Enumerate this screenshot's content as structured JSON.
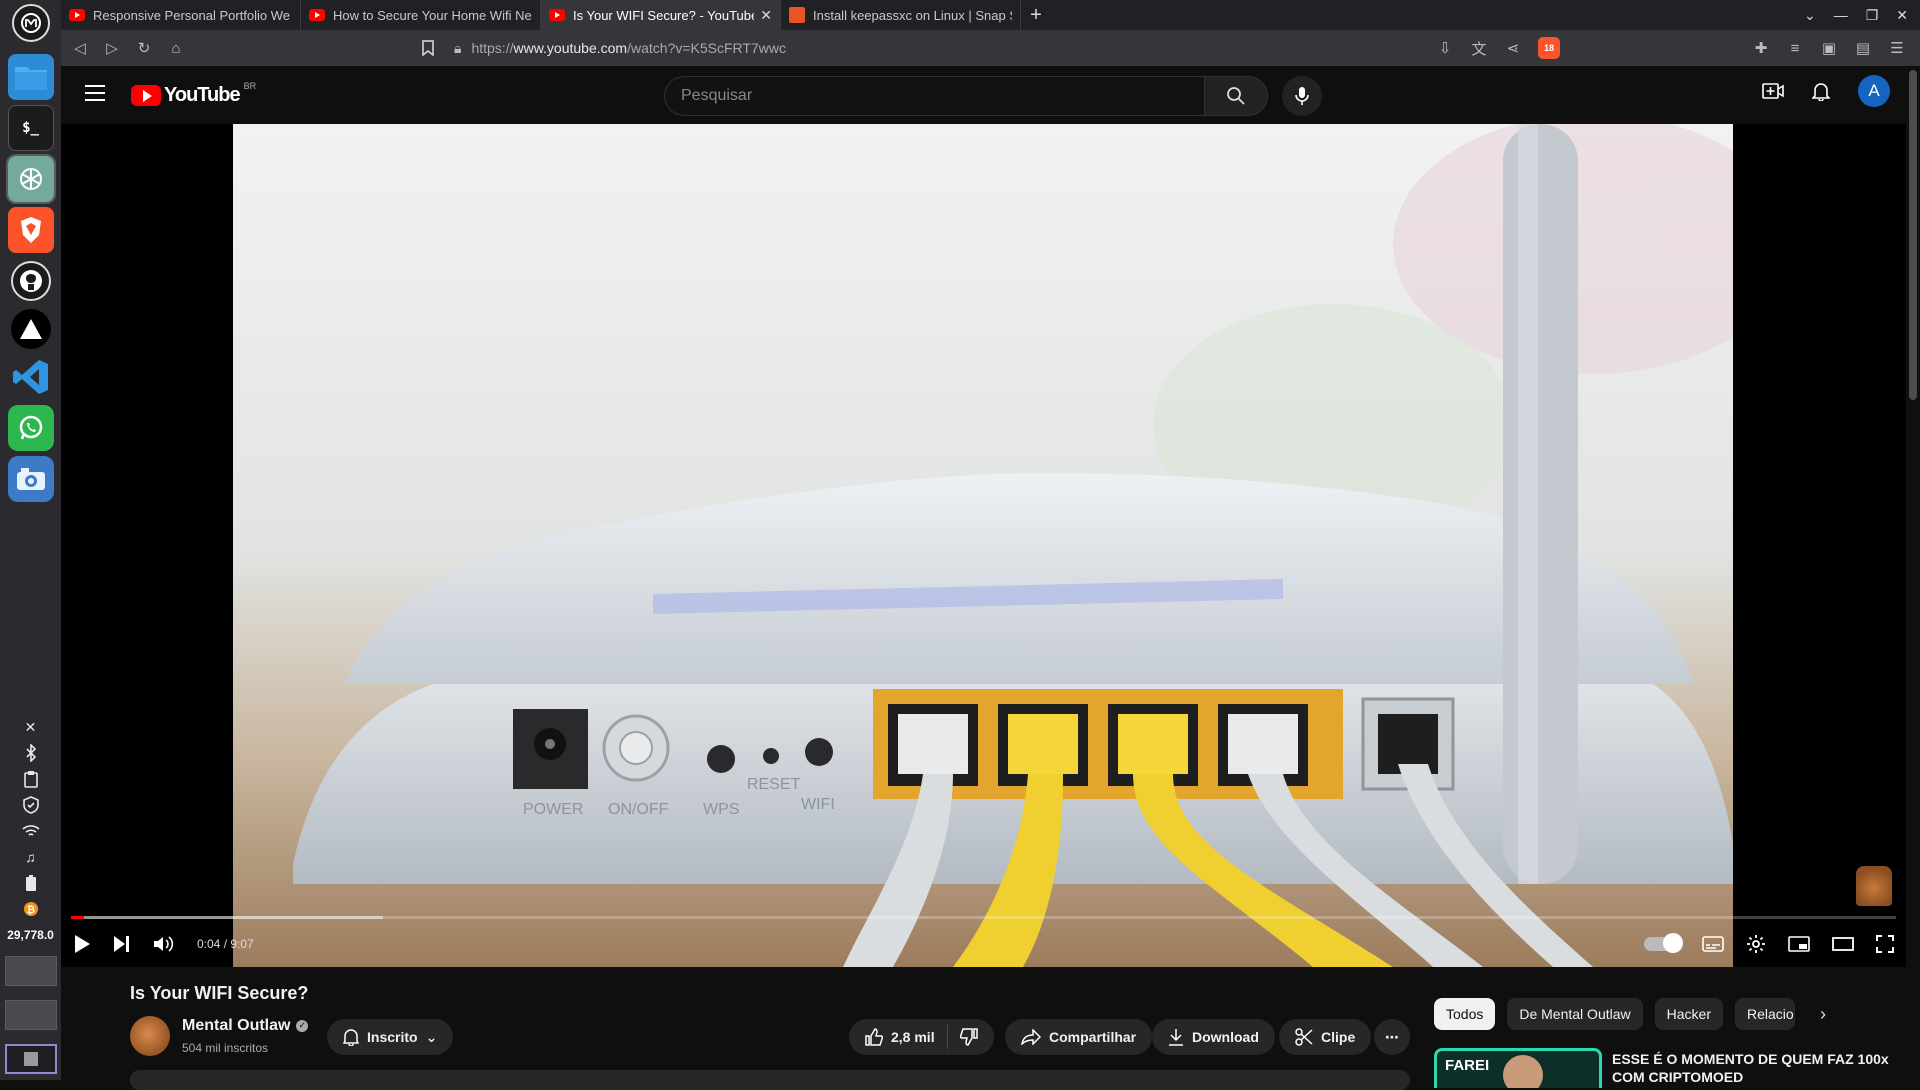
{
  "browser": {
    "tabs": [
      {
        "title": "Responsive Personal Portfolio We",
        "favicon": "youtube-icon"
      },
      {
        "title": "How to Secure Your Home Wifi Ne",
        "favicon": "youtube-icon"
      },
      {
        "title": "Is Your WIFI Secure? - YouTube",
        "favicon": "youtube-icon",
        "active": true
      },
      {
        "title": "Install keepassxc on Linux | Snap S",
        "favicon": "snapcraft-icon"
      }
    ],
    "url_scheme": "https://",
    "url_host": "www.youtube.com",
    "url_path": "/watch?v=K5ScFRT7wwc",
    "shield_badge": "18"
  },
  "dock": {
    "apps": [
      "launcher-icon",
      "files-icon",
      "terminal-icon",
      "chatgpt-icon",
      "brave-icon",
      "github-icon",
      "vercel-icon",
      "vscode-icon",
      "whatsapp-icon",
      "camera-icon"
    ],
    "terminal_label": "$_",
    "btc_value": "29,778.0"
  },
  "youtube": {
    "logo_text": "YouTube",
    "country": "BR",
    "search_placeholder": "Pesquisar",
    "avatar_letter": "A"
  },
  "player": {
    "current_time": "0:04",
    "duration": "9:07",
    "time_display": "0:04 / 9:07",
    "progress": 0.007,
    "buffered": 0.171
  },
  "video": {
    "title": "Is Your WIFI Secure?",
    "channel": "Mental Outlaw",
    "subscribers": "504 mil inscritos",
    "subscribe_label": "Inscrito",
    "likes": "2,8 mil",
    "share_label": "Compartilhar",
    "download_label": "Download",
    "clip_label": "Clipe",
    "router_labels": [
      "POWER",
      "ON/OFF",
      "WPS",
      "RESET",
      "WIFI"
    ]
  },
  "chips": [
    "Todos",
    "De Mental Outlaw",
    "Hacker",
    "Relacio"
  ],
  "recommendation": {
    "thumb_text": "FAREI",
    "title": "ESSE É O MOMENTO DE QUEM FAZ 100x COM CRIPTOMOED"
  },
  "colors": {
    "accent_red": "#ff0000",
    "avatar_blue": "#1565c0",
    "background": "#0f0f0f"
  }
}
